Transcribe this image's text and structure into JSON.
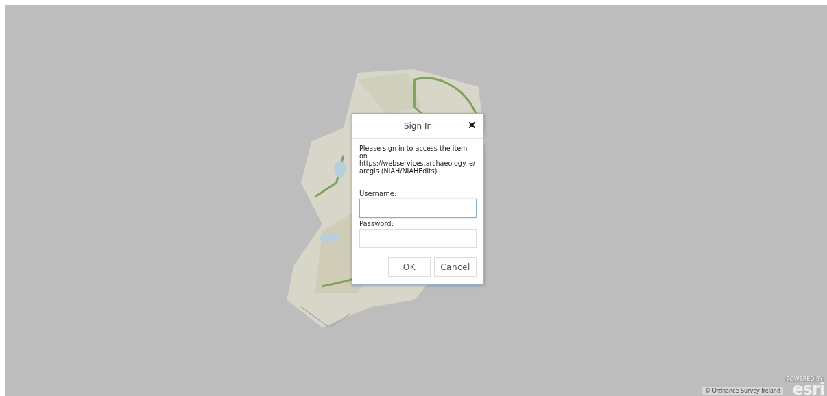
{
  "dialog": {
    "title": "Sign In",
    "close": "✕",
    "message": "Please sign in to access the item on https://webservices.archaeology.ie/arcgis (NIAH/NIAHEdits)",
    "fields": [
      {
        "label": "Username:",
        "focused": true
      },
      {
        "label": "Password:",
        "focused": false
      }
    ],
    "buttons": [
      "OK",
      "Cancel"
    ]
  },
  "attribution": "© Ordnance Survey Ireland",
  "logo": {
    "tagline": "POWERED BY",
    "name": "esri"
  }
}
